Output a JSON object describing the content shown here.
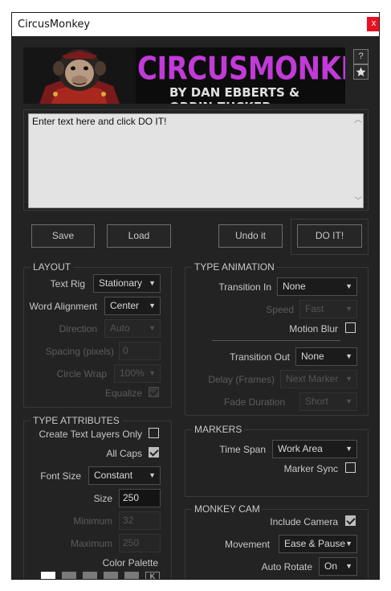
{
  "window": {
    "title": "CircusMonkey",
    "close_label": "x"
  },
  "banner": {
    "title": "CIRCUSMONKEY",
    "subtitle": "BY DAN EBBERTS & ORRIN ZUCKER"
  },
  "side_buttons": {
    "help_label": "?",
    "star_icon": "star-icon"
  },
  "text_input": {
    "value": "Enter text here and click DO IT!"
  },
  "buttons": {
    "save": "Save",
    "load": "Load",
    "undo": "Undo it",
    "do_it": "DO IT!"
  },
  "layout": {
    "title": "LAYOUT",
    "text_rig": {
      "label": "Text Rig",
      "value": "Stationary"
    },
    "word_alignment": {
      "label": "Word Alignment",
      "value": "Center"
    },
    "direction": {
      "label": "Direction",
      "value": "Auto"
    },
    "spacing": {
      "label": "Spacing (pixels)",
      "value": "0"
    },
    "circle_wrap": {
      "label": "Circle Wrap",
      "value": "100%"
    },
    "equalize": {
      "label": "Equalize",
      "checked": true
    }
  },
  "type_animation": {
    "title": "TYPE ANIMATION",
    "transition_in": {
      "label": "Transition In",
      "value": "None"
    },
    "speed": {
      "label": "Speed",
      "value": "Fast"
    },
    "motion_blur": {
      "label": "Motion Blur",
      "checked": false
    },
    "transition_out": {
      "label": "Transition Out",
      "value": "None"
    },
    "delay": {
      "label": "Delay (Frames)",
      "value": "Next Marker"
    },
    "fade_duration": {
      "label": "Fade Duration",
      "value": "Short"
    }
  },
  "type_attributes": {
    "title": "TYPE ATTRIBUTES",
    "create_text_layers_only": {
      "label": "Create Text Layers Only",
      "checked": false
    },
    "all_caps": {
      "label": "All Caps",
      "checked": true
    },
    "font_size": {
      "label": "Font Size",
      "value": "Constant"
    },
    "size": {
      "label": "Size",
      "value": "250"
    },
    "minimum": {
      "label": "Minimum",
      "value": "32"
    },
    "maximum": {
      "label": "Maximum",
      "value": "250"
    },
    "color_palette": {
      "label": "Color Palette",
      "key_label": "K",
      "swatches": [
        "#ffffff",
        "#7a7a7a",
        "#7a7a7a",
        "#7a7a7a",
        "#7a7a7a"
      ]
    }
  },
  "markers": {
    "title": "MARKERS",
    "time_span": {
      "label": "Time Span",
      "value": "Work Area"
    },
    "marker_sync": {
      "label": "Marker Sync",
      "checked": false
    }
  },
  "monkey_cam": {
    "title": "MONKEY CAM",
    "include_camera": {
      "label": "Include Camera",
      "checked": true
    },
    "movement": {
      "label": "Movement",
      "value": "Ease & Pause"
    },
    "auto_rotate": {
      "label": "Auto Rotate",
      "value": "On"
    }
  },
  "colors": {
    "accent": "#c23ad8",
    "background": "#232323",
    "close": "#e81123"
  }
}
